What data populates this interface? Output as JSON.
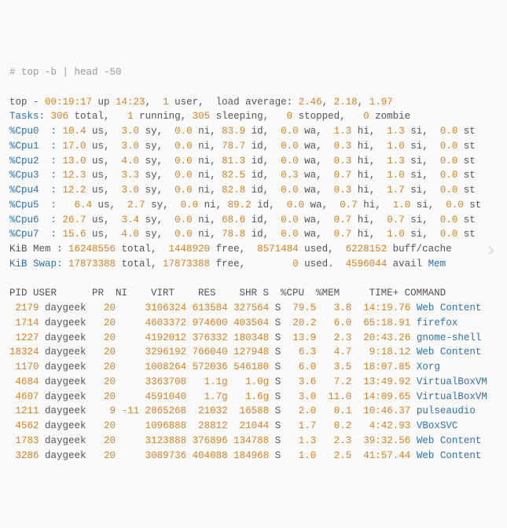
{
  "input": {
    "prompt": "# ",
    "cmd": "top -b | head -50"
  },
  "header": {
    "label": "top - ",
    "time": "00:19:17",
    "upLabel": " up ",
    "up": "14:23",
    "users": "1",
    "usersLbl": " user,  load average: ",
    "la1": "2.46",
    "la2": "2.18",
    "la3": "1.97"
  },
  "tasks": {
    "lbl": "Tasks: ",
    "total": "306",
    "totalLbl": " total,   ",
    "run": "1",
    "runLbl": " running, ",
    "sleep": "305",
    "sleepLbl": " sleeping,   ",
    "stop": "0",
    "stopLbl": " stopped,   ",
    "zomb": "0",
    "zombLbl": " zombie"
  },
  "cpus": [
    {
      "n": "%Cpu0  : ",
      "us": "10.4",
      "sy": "3.0",
      "ni": "0.0",
      "id": "83.9",
      "wa": "0.0",
      "hi": "1.3",
      "si": "1.3",
      "st": "0.0"
    },
    {
      "n": "%Cpu1  : ",
      "us": "17.0",
      "sy": "3.0",
      "ni": "0.0",
      "id": "78.7",
      "wa": "0.0",
      "hi": "0.3",
      "si": "1.0",
      "st": "0.0"
    },
    {
      "n": "%Cpu2  : ",
      "us": "13.0",
      "sy": "4.0",
      "ni": "0.0",
      "id": "81.3",
      "wa": "0.0",
      "hi": "0.3",
      "si": "1.3",
      "st": "0.0"
    },
    {
      "n": "%Cpu3  : ",
      "us": "12.3",
      "sy": "3.3",
      "ni": "0.0",
      "id": "82.5",
      "wa": "0.3",
      "hi": "0.7",
      "si": "1.0",
      "st": "0.0"
    },
    {
      "n": "%Cpu4  : ",
      "us": "12.2",
      "sy": "3.0",
      "ni": "0.0",
      "id": "82.8",
      "wa": "0.0",
      "hi": "0.3",
      "si": "1.7",
      "st": "0.0"
    },
    {
      "n": "%Cpu5  :  ",
      "us": "6.4",
      "sy": "2.7",
      "ni": "0.0",
      "id": "89.2",
      "wa": "0.0",
      "hi": "0.7",
      "si": "1.0",
      "st": "0.0"
    },
    {
      "n": "%Cpu6  : ",
      "us": "26.7",
      "sy": "3.4",
      "ni": "0.0",
      "id": "68.6",
      "wa": "0.0",
      "hi": "0.7",
      "si": "0.7",
      "st": "0.0"
    },
    {
      "n": "%Cpu7  : ",
      "us": "15.6",
      "sy": "4.0",
      "ni": "0.0",
      "id": "78.8",
      "wa": "0.0",
      "hi": "0.7",
      "si": "1.0",
      "st": "0.0"
    }
  ],
  "mem": {
    "lbl": "KiB Mem : ",
    "total": "16248556",
    "totalLbl": " total,  ",
    "free": "1448920",
    "freeLbl": " free,  ",
    "used": "8571484",
    "usedLbl": " used,  ",
    "buff": "6228152",
    "buffLbl": " buff/cache"
  },
  "swap": {
    "lbl": "KiB Swap: ",
    "total": "17873388",
    "totalLbl": " total, ",
    "free": "17873388",
    "freeLbl": " free,        ",
    "used": "0",
    "usedLbl": " used.  ",
    "avail": "4596044",
    "availLbl": " avail ",
    "memLbl": "Mem"
  },
  "cols": "PID USER      PR  NI    VIRT    RES    SHR S  %CPU  %MEM     TIME+ COMMAND",
  "procs": [
    {
      "pid": "2179",
      "user": "daygeek",
      "pr": "20",
      "ni": "",
      "virt": "3106324",
      "res": "613584",
      "shr": "327564",
      "s": "S",
      "cpu": "79.5",
      "mem": "3.8",
      "time": "14:19.76",
      "cmd": "Web Content"
    },
    {
      "pid": "1714",
      "user": "daygeek",
      "pr": "20",
      "ni": "",
      "virt": "4603372",
      "res": "974600",
      "shr": "403504",
      "s": "S",
      "cpu": "20.2",
      "mem": "6.0",
      "time": "65:18.91",
      "cmd": "firefox"
    },
    {
      "pid": "1227",
      "user": "daygeek",
      "pr": "20",
      "ni": "",
      "virt": "4192012",
      "res": "376332",
      "shr": "180348",
      "s": "S",
      "cpu": "13.9",
      "mem": "2.3",
      "time": "20:43.26",
      "cmd": "gnome-shell"
    },
    {
      "pid": "18324",
      "user": "daygeek",
      "pr": "20",
      "ni": "",
      "virt": "3296192",
      "res": "766040",
      "shr": "127948",
      "s": "S",
      "cpu": "6.3",
      "mem": "4.7",
      "time": "9:18.12",
      "cmd": "Web Content"
    },
    {
      "pid": "1170",
      "user": "daygeek",
      "pr": "20",
      "ni": "",
      "virt": "1008264",
      "res": "572036",
      "shr": "546180",
      "s": "S",
      "cpu": "6.0",
      "mem": "3.5",
      "time": "18:07.85",
      "cmd": "Xorg"
    },
    {
      "pid": "4684",
      "user": "daygeek",
      "pr": "20",
      "ni": "",
      "virt": "3363708",
      "res": "1.1g",
      "shr": "1.0g",
      "s": "S",
      "cpu": "3.6",
      "mem": "7.2",
      "time": "13:49.92",
      "cmd": "VirtualBoxVM"
    },
    {
      "pid": "4607",
      "user": "daygeek",
      "pr": "20",
      "ni": "",
      "virt": "4591040",
      "res": "1.7g",
      "shr": "1.6g",
      "s": "S",
      "cpu": "3.0",
      "mem": "11.0",
      "time": "14:09.65",
      "cmd": "VirtualBoxVM"
    },
    {
      "pid": "1211",
      "user": "daygeek",
      "pr": "9",
      "ni": "-11",
      "virt": "2865268",
      "res": "21032",
      "shr": "16588",
      "s": "S",
      "cpu": "2.0",
      "mem": "0.1",
      "time": "10:46.37",
      "cmd": "pulseaudio"
    },
    {
      "pid": "4562",
      "user": "daygeek",
      "pr": "20",
      "ni": "",
      "virt": "1096888",
      "res": "28812",
      "shr": "21044",
      "s": "S",
      "cpu": "1.7",
      "mem": "0.2",
      "time": "4:42.93",
      "cmd": "VBoxSVC"
    },
    {
      "pid": "1783",
      "user": "daygeek",
      "pr": "20",
      "ni": "",
      "virt": "3123888",
      "res": "376896",
      "shr": "134788",
      "s": "S",
      "cpu": "1.3",
      "mem": "2.3",
      "time": "39:32.56",
      "cmd": "Web Content"
    },
    {
      "pid": "3286",
      "user": "daygeek",
      "pr": "20",
      "ni": "",
      "virt": "3089736",
      "res": "404088",
      "shr": "184968",
      "s": "S",
      "cpu": "1.0",
      "mem": "2.5",
      "time": "41:57.44",
      "cmd": "Web Content"
    }
  ]
}
